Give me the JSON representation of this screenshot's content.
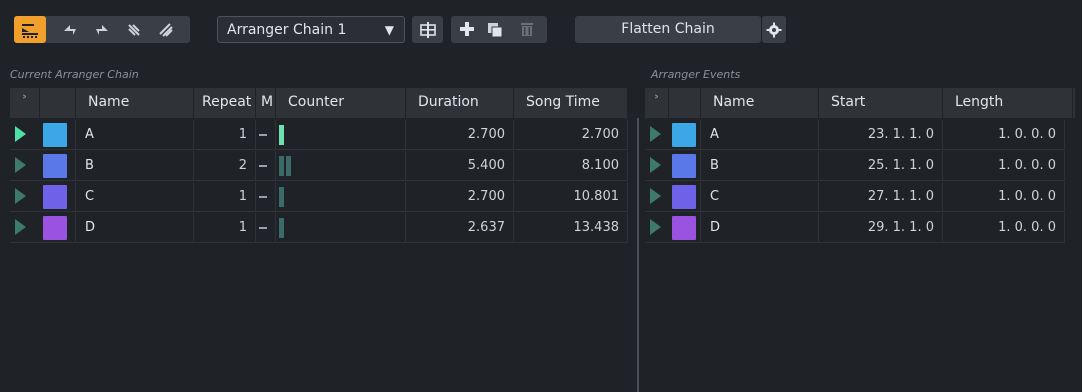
{
  "toolbar": {
    "mode_icons": [
      "arranger-mode-icon",
      "jump-backward-icon",
      "jump-forward-icon",
      "loop-mode-icon",
      "cycle-mode-icon"
    ],
    "chain_select_value": "Arranger Chain 1",
    "flatten_label": "Flatten Chain",
    "accent_color": "#f2a02b"
  },
  "left": {
    "title": "Current Arranger Chain",
    "columns": [
      "˃",
      "",
      "Name",
      "Repeat",
      "M",
      "Counter",
      "Duration",
      "Song Time"
    ],
    "rows": [
      {
        "name": "A",
        "repeat": "1",
        "mode": "–",
        "counter": 1,
        "duration": "2.700",
        "song_time": "2.700",
        "color": "#3ba7e6",
        "active": true
      },
      {
        "name": "B",
        "repeat": "2",
        "mode": "–",
        "counter": 2,
        "duration": "5.400",
        "song_time": "8.100",
        "color": "#5b78e8",
        "active": false
      },
      {
        "name": "C",
        "repeat": "1",
        "mode": "–",
        "counter": 1,
        "duration": "2.700",
        "song_time": "10.801",
        "color": "#6e63e8",
        "active": false
      },
      {
        "name": "D",
        "repeat": "1",
        "mode": "–",
        "counter": 1,
        "duration": "2.637",
        "song_time": "13.438",
        "color": "#9a52e0",
        "active": false
      }
    ]
  },
  "right": {
    "title": "Arranger Events",
    "columns": [
      "˃",
      "",
      "Name",
      "Start",
      "Length"
    ],
    "rows": [
      {
        "name": "A",
        "start": "23. 1. 1. 0",
        "length": "1. 0. 0. 0",
        "color": "#3ba7e6"
      },
      {
        "name": "B",
        "start": "25. 1. 1. 0",
        "length": "1. 0. 0. 0",
        "color": "#5b78e8"
      },
      {
        "name": "C",
        "start": "27. 1. 1. 0",
        "length": "1. 0. 0. 0",
        "color": "#6e63e8"
      },
      {
        "name": "D",
        "start": "29. 1. 1. 0",
        "length": "1. 0. 0. 0",
        "color": "#9a52e0"
      }
    ]
  }
}
